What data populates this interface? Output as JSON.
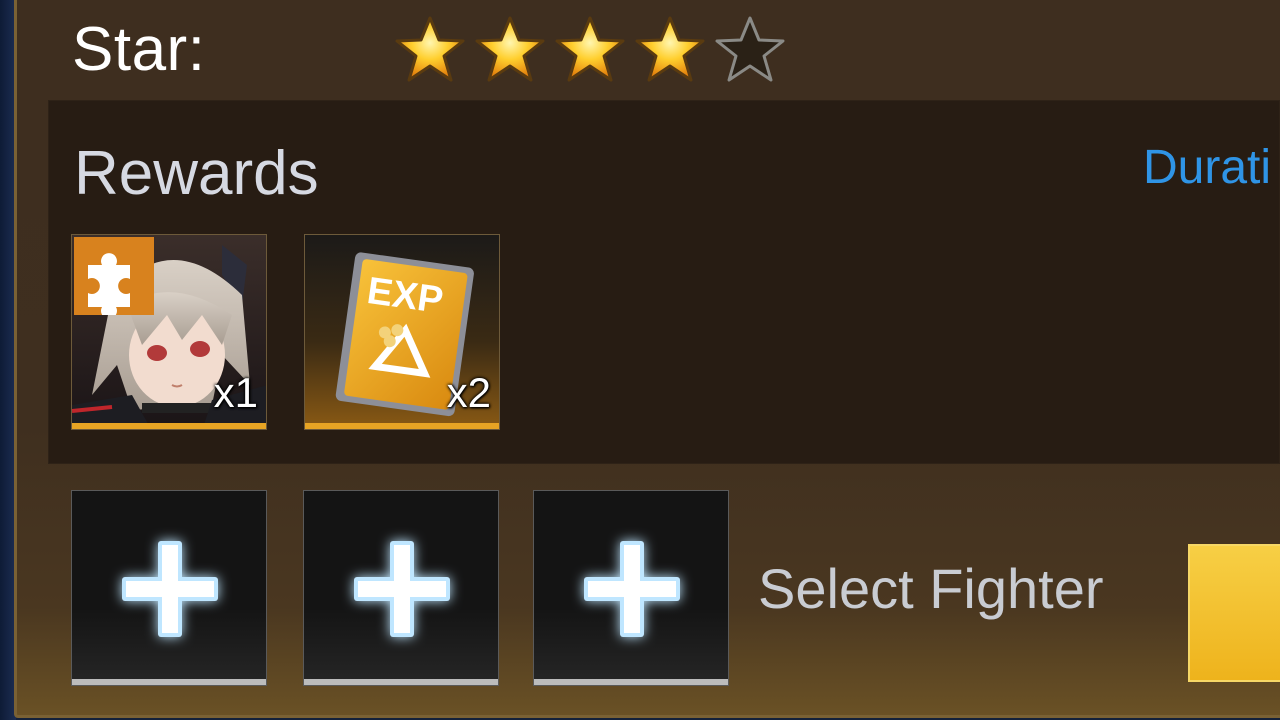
{
  "star_row": {
    "label": "Star:",
    "rating": 4,
    "max": 5,
    "filled_color": "#f7b21c",
    "empty_color": "#2a2116"
  },
  "rewards": {
    "title": "Rewards",
    "duration_label": "Durati",
    "items": [
      {
        "kind": "fighter-shard",
        "icon": "puzzle-piece-icon",
        "quantity": "x1"
      },
      {
        "kind": "exp-card",
        "icon": "exp-card-icon",
        "card_text": "EXP",
        "quantity": "x2"
      }
    ]
  },
  "team": {
    "slots": [
      {
        "icon": "plus-icon"
      },
      {
        "icon": "plus-icon"
      },
      {
        "icon": "plus-icon"
      }
    ],
    "select_label": "Select Fighter"
  },
  "colors": {
    "panel": "#3e2e1f",
    "rewards_bg": "#271c13",
    "accent_blue": "#2f94e6",
    "gold": "#f0b41e"
  }
}
